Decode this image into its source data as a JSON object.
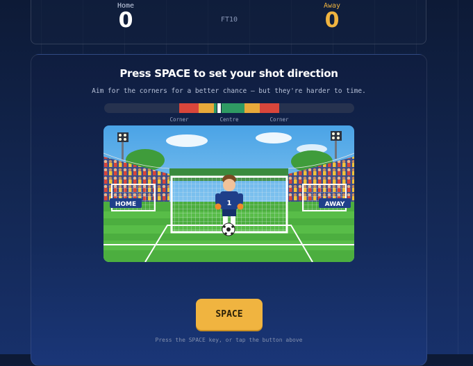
{
  "scoreboard": {
    "home_label": "Home",
    "home_score": "0",
    "away_label": "Away",
    "away_score": "0",
    "match_format": "FT10"
  },
  "prompt": {
    "title": "Press SPACE to set your shot direction",
    "subtitle": "Aim for the corners for a better chance — but they're harder to time."
  },
  "meter": {
    "left_label": "Corner",
    "centre_label": "Centre",
    "right_label": "Corner",
    "marker_position": 0.46,
    "colors": {
      "corner": "#d8463b",
      "mid": "#e8a93a",
      "centre": "#2f9a63",
      "track": "#26324f"
    }
  },
  "scene": {
    "left_goal_label": "HOME",
    "right_goal_label": "AWAY",
    "keeper_number": "1"
  },
  "controls": {
    "space_label": "SPACE",
    "hint": "Press the SPACE key, or tap the button above"
  },
  "colors": {
    "accent": "#f0b440",
    "background": "#0d1a36"
  }
}
